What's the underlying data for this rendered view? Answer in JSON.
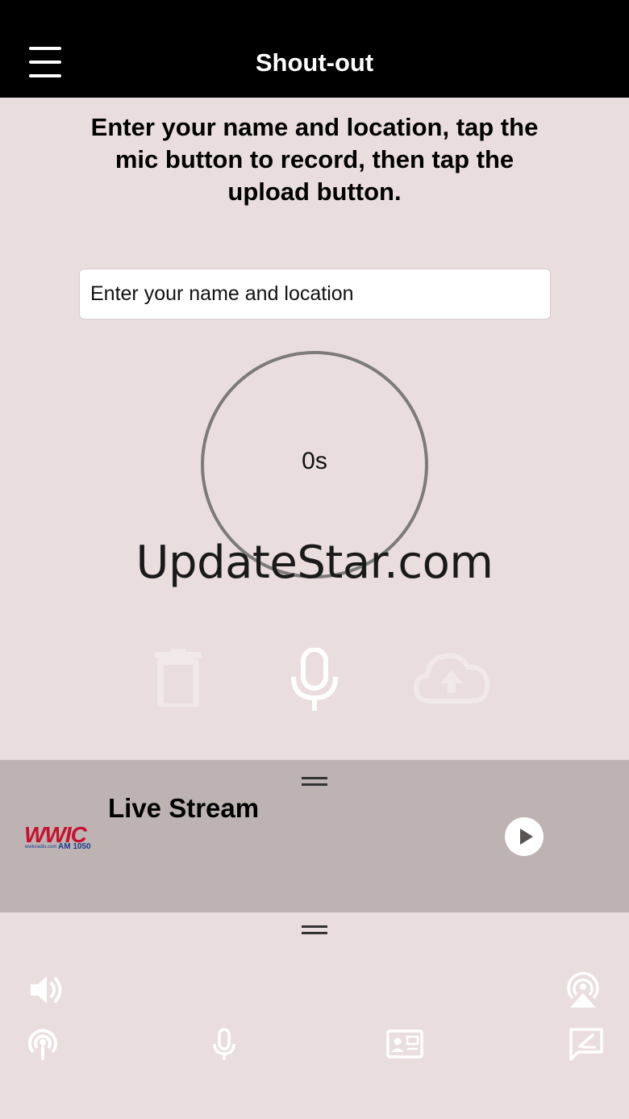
{
  "header": {
    "title": "Shout-out",
    "menu_icon": "hamburger-menu-icon"
  },
  "instructions": "Enter your name and location, tap the mic button to record, then tap the upload button.",
  "name_input": {
    "placeholder": "Enter your name and location",
    "value": ""
  },
  "timer": {
    "value": "0s"
  },
  "watermark": "UpdateStar.com",
  "actions": {
    "delete_icon": "trash-icon",
    "record_icon": "microphone-icon",
    "upload_icon": "cloud-upload-icon"
  },
  "player": {
    "title": "Live Stream",
    "logo_text": "WWIC",
    "logo_subtext": "AM 1050",
    "logo_url_text": "wwicradio.com",
    "play_icon": "play-icon"
  },
  "bottom_toolbar": {
    "row1": [
      "volume-icon",
      "airplay-icon"
    ],
    "row2": [
      "podcast-icon",
      "microphone-icon",
      "contact-card-icon",
      "message-edit-icon"
    ]
  },
  "colors": {
    "background": "#e9dedd",
    "header": "#000000",
    "player_background": "#bdb3b3",
    "logo_red": "#c8102e",
    "logo_blue": "#1d3a8a"
  }
}
